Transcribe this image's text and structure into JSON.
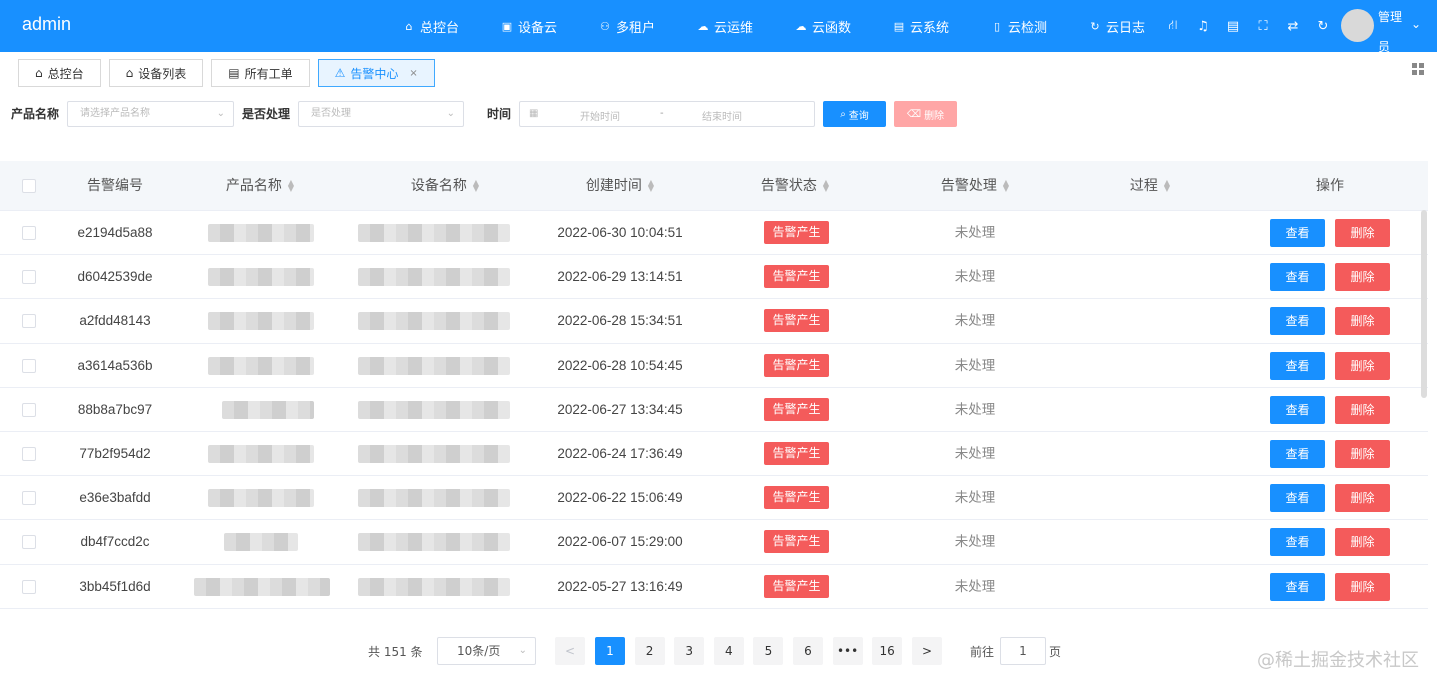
{
  "app": {
    "brand": "admin"
  },
  "nav": [
    {
      "label": "总控台",
      "icon": "home-icon"
    },
    {
      "label": "设备云",
      "icon": "device-icon"
    },
    {
      "label": "多租户",
      "icon": "users-icon"
    },
    {
      "label": "云运维",
      "icon": "cloud-icon"
    },
    {
      "label": "云函数",
      "icon": "cloud-function-icon"
    },
    {
      "label": "云系统",
      "icon": "system-icon"
    },
    {
      "label": "云检测",
      "icon": "detect-icon"
    },
    {
      "label": "云日志",
      "icon": "log-icon"
    }
  ],
  "user": {
    "name": "管理员"
  },
  "tabs": [
    {
      "label": "总控台"
    },
    {
      "label": "设备列表"
    },
    {
      "label": "所有工单"
    },
    {
      "label": "告警中心",
      "close": "×"
    }
  ],
  "filter": {
    "product_label": "产品名称",
    "product_placeholder": "请选择产品名称",
    "handled_label": "是否处理",
    "handled_placeholder": "是否处理",
    "time_label": "时间",
    "start_placeholder": "开始时间",
    "separator": "-",
    "end_placeholder": "结束时间",
    "search_label": "查询",
    "delete_label": "删除"
  },
  "table": {
    "headers": [
      "告警编号",
      "产品名称",
      "设备名称",
      "创建时间",
      "告警状态",
      "告警处理",
      "过程",
      "操作"
    ],
    "rows": [
      {
        "id": "e2194d5a88",
        "created": "2022-06-30 10:04:51",
        "state": "告警产生",
        "handling": "未处理"
      },
      {
        "id": "d6042539de",
        "created": "2022-06-29 13:14:51",
        "state": "告警产生",
        "handling": "未处理"
      },
      {
        "id": "a2fdd48143",
        "created": "2022-06-28 15:34:51",
        "state": "告警产生",
        "handling": "未处理"
      },
      {
        "id": "a3614a536b",
        "created": "2022-06-28 10:54:45",
        "state": "告警产生",
        "handling": "未处理"
      },
      {
        "id": "88b8a7bc97",
        "created": "2022-06-27 13:34:45",
        "state": "告警产生",
        "handling": "未处理"
      },
      {
        "id": "77b2f954d2",
        "created": "2022-06-24 17:36:49",
        "state": "告警产生",
        "handling": "未处理"
      },
      {
        "id": "e36e3bafdd",
        "created": "2022-06-22 15:06:49",
        "state": "告警产生",
        "handling": "未处理"
      },
      {
        "id": "db4f7ccd2c",
        "created": "2022-06-07 15:29:00",
        "state": "告警产生",
        "handling": "未处理"
      },
      {
        "id": "3bb45f1d6d",
        "created": "2022-05-27 13:16:49",
        "state": "告警产生",
        "handling": "未处理"
      }
    ],
    "view_label": "查看",
    "delete_label": "删除"
  },
  "pagination": {
    "total": "共 151 条",
    "page_size": "10条/页",
    "prev": "<",
    "pages": [
      "1",
      "2",
      "3",
      "4",
      "5",
      "6",
      "•••",
      "16"
    ],
    "current": "1",
    "next": ">",
    "goto_label": "前往",
    "goto_value": "1",
    "page_unit": "页"
  },
  "watermark": "@稀土掘金技术社区"
}
